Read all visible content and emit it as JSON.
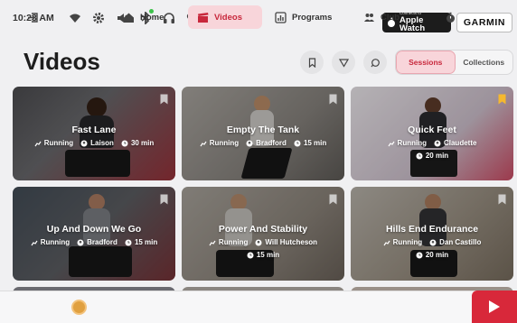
{
  "status": {
    "time": "10:23 AM"
  },
  "integrations": {
    "apple_watch_small": "Connects to",
    "apple_watch_label": "Apple Watch",
    "garmin_label": "GARMIN"
  },
  "header": {
    "title": "Videos",
    "segments": [
      {
        "label": "Sessions",
        "active": true
      },
      {
        "label": "Collections",
        "active": false
      }
    ]
  },
  "cards": [
    {
      "title": "Fast Lane",
      "activity": "Running",
      "instructor": "Laison",
      "duration": "30 min",
      "bookmarked": false
    },
    {
      "title": "Empty The Tank",
      "activity": "Running",
      "instructor": "Bradford",
      "duration": "15 min",
      "bookmarked": false
    },
    {
      "title": "Quick Feet",
      "activity": "Running",
      "instructor": "Claudette",
      "duration": "20 min",
      "bookmarked": true
    },
    {
      "title": "Up And Down We Go",
      "activity": "Running",
      "instructor": "Bradford",
      "duration": "15 min",
      "bookmarked": false
    },
    {
      "title": "Power And Stability",
      "activity": "Running",
      "instructor": "Will Hutcheson",
      "duration": "15 min",
      "bookmarked": false
    },
    {
      "title": "Hills End Endurance",
      "activity": "Running",
      "instructor": "Dan Castillo",
      "duration": "20 min",
      "bookmarked": false
    }
  ],
  "nav": {
    "home": "Home",
    "videos": "Videos",
    "programs": "Programs",
    "club": "Club"
  },
  "colors": {
    "accent": "#d8283a",
    "active_bg": "#f8d5da",
    "bookmark": "#f5b82e"
  }
}
